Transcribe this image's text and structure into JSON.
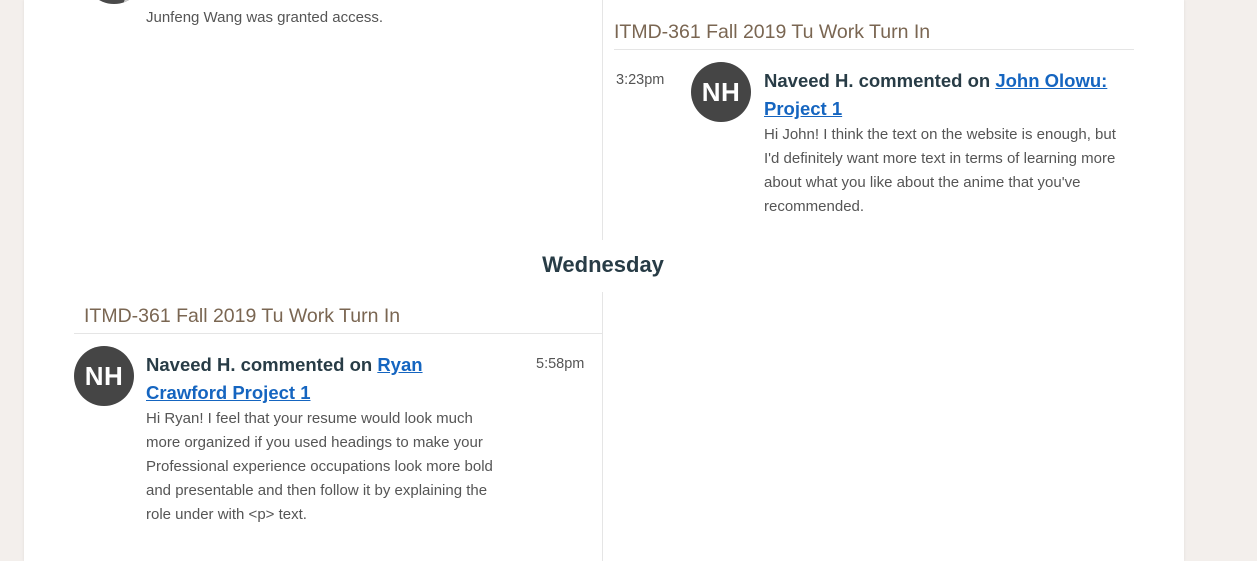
{
  "top_activity": {
    "text": "Junfeng Wang was granted access."
  },
  "right_group": {
    "course": "ITMD-361 Fall 2019 Tu Work Turn In",
    "time": "3:23pm",
    "avatar_initials": "NH",
    "actor_text": "Naveed H. commented on",
    "link_text": "John Olowu: Project 1",
    "comment": "Hi John! I think the text on the website is enough, but I'd definitely want more text in terms of learning more about what you like about the anime that you've recommended."
  },
  "day_label": "Wednesday",
  "left_group": {
    "course": "ITMD-361 Fall 2019 Tu Work Turn In",
    "time": "5:58pm",
    "avatar_initials": "NH",
    "actor_text": "Naveed H. commented on",
    "link_text": "Ryan Crawford Project 1",
    "comment": "Hi Ryan! I feel that your resume would look much more organized if you used headings to make your Professional experience occupations look more bold and presentable and then follow it by explaining the role under with <p> text."
  },
  "colors": {
    "page_bg": "#f3efec",
    "card_bg": "#ffffff",
    "heading_text": "#283c46",
    "course_header": "#7a6652",
    "link": "#1565c0",
    "avatar_bg": "#454545"
  }
}
